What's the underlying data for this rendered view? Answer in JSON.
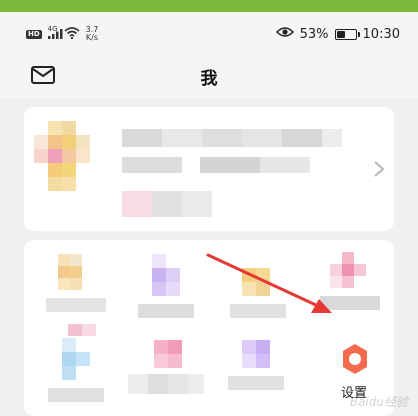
{
  "status_bar": {
    "hd_badge": "HD",
    "signal_label": "4G",
    "network_speed": "3.7\nK/s",
    "battery_percent": "53%",
    "time": "10:30",
    "battery_level": 0.53
  },
  "header": {
    "title": "我",
    "mail_icon": "mail-icon"
  },
  "profile_card": {
    "chevron_icon": "chevron-right-icon"
  },
  "feature_grid": {
    "settings_label": "设置",
    "settings_icon": "settings-gear-icon"
  },
  "annotation": {
    "arrow_color": "#e53935"
  },
  "watermark": {
    "text": "Baidu经验"
  },
  "colors": {
    "top_bar": "#7cb93a",
    "settings_icon": "#f36b4f"
  }
}
